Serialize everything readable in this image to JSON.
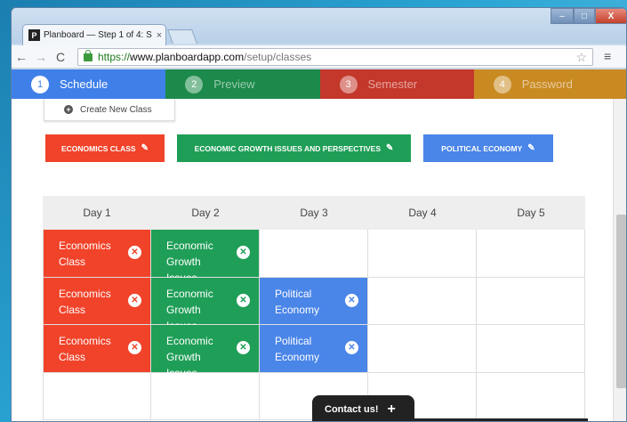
{
  "browser": {
    "tab_title": "Planboard — Step 1 of 4: S",
    "tab_close": "×",
    "favicon": "P",
    "url_proto": "https://",
    "url_host": "www.planboardapp.com",
    "url_path": "/setup/classes",
    "back": "←",
    "forward": "→",
    "reload": "C",
    "star": "☆",
    "menu": "≡",
    "min": "–",
    "max": "□",
    "close": "X"
  },
  "steps": [
    {
      "num": "1",
      "label": "Schedule",
      "color": "#3f7fe8",
      "active": true
    },
    {
      "num": "2",
      "label": "Preview",
      "color": "#1c8a4a",
      "active": false
    },
    {
      "num": "3",
      "label": "Semester",
      "color": "#c4372b",
      "active": false
    },
    {
      "num": "4",
      "label": "Password",
      "color": "#c98a22",
      "active": false
    }
  ],
  "create_button": "Create New Class",
  "classes": [
    {
      "label": "ECONOMICS CLASS",
      "color": "#f1432a"
    },
    {
      "label": "ECONOMIC GROWTH ISSUES AND PERSPECTIVES",
      "color": "#1f9e57"
    },
    {
      "label": "POLITICAL ECONOMY",
      "color": "#4a85e8"
    }
  ],
  "days": [
    "Day 1",
    "Day 2",
    "Day 3",
    "Day 4",
    "Day 5"
  ],
  "schedule": [
    {
      "day1": "Economics Class",
      "day2": "Economic Growth Issues",
      "day3": ""
    },
    {
      "day1": "Economics Class",
      "day2": "Economic Growth Issues",
      "day3": "Political Economy"
    },
    {
      "day1": "Economics Class",
      "day2": "Economic Growth Issues",
      "day3": "Political Economy"
    }
  ],
  "remove_glyph": "✕",
  "contact": {
    "label": "Contact us!",
    "plus": "+"
  }
}
